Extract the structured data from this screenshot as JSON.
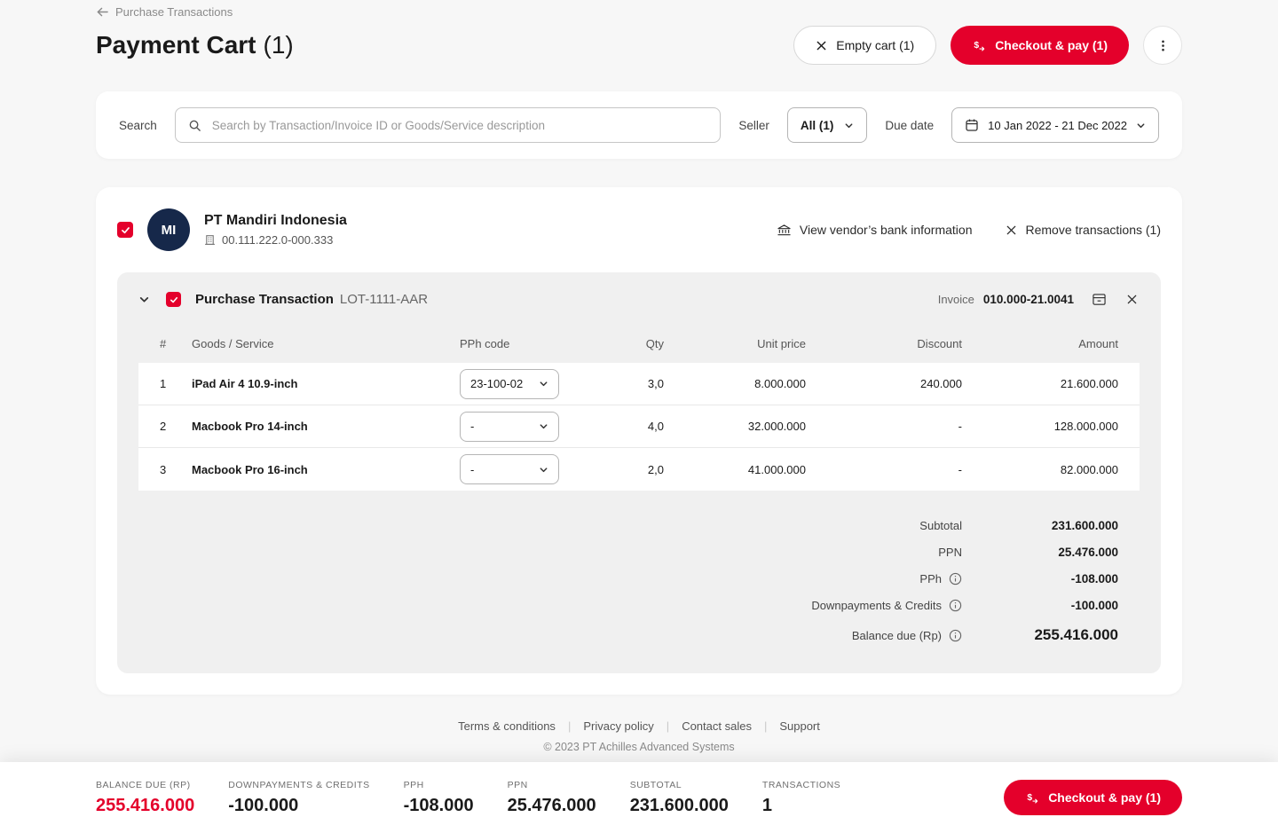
{
  "colors": {
    "accent": "#e4002b",
    "avatar_bg": "#16284a"
  },
  "header": {
    "back_label": "Purchase Transactions",
    "title": "Payment Cart",
    "title_count": "(1)",
    "empty_cart_label": "Empty cart (1)",
    "checkout_label": "Checkout & pay (1)"
  },
  "filters": {
    "search_label": "Search",
    "search_placeholder": "Search by Transaction/Invoice ID or Goods/Service description",
    "seller_label": "Seller",
    "seller_value": "All (1)",
    "due_date_label": "Due date",
    "due_date_value": "10 Jan 2022 - 21 Dec 2022"
  },
  "vendor": {
    "initials": "MI",
    "name": "PT Mandiri Indonesia",
    "tax_id": "00.111.222.0-000.333",
    "bank_info_label": "View vendor’s bank information",
    "remove_label": "Remove transactions (1)"
  },
  "transaction": {
    "title": "Purchase Transaction",
    "id": "LOT-1111-AAR",
    "invoice_label": "Invoice",
    "invoice_number": "010.000-21.0041"
  },
  "table": {
    "headers": [
      "#",
      "Goods / Service",
      "PPh code",
      "Qty",
      "Unit price",
      "Discount",
      "Amount"
    ],
    "rows": [
      {
        "num": "1",
        "goods": "iPad Air 4 10.9-inch",
        "pph_code": "23-100-02",
        "qty": "3,0",
        "unit_price": "8.000.000",
        "discount": "240.000",
        "amount": "21.600.000"
      },
      {
        "num": "2",
        "goods": "Macbook Pro 14-inch",
        "pph_code": "-",
        "qty": "4,0",
        "unit_price": "32.000.000",
        "discount": "-",
        "amount": "128.000.000"
      },
      {
        "num": "3",
        "goods": "Macbook Pro 16-inch",
        "pph_code": "-",
        "qty": "2,0",
        "unit_price": "41.000.000",
        "discount": "-",
        "amount": "82.000.000"
      }
    ]
  },
  "totals": [
    {
      "label": "Subtotal",
      "value": "231.600.000"
    },
    {
      "label": "PPN",
      "value": "25.476.000"
    },
    {
      "label": "PPh",
      "value": "-108.000"
    },
    {
      "label": "Downpayments & Credits",
      "value": "-100.000"
    },
    {
      "label": "Balance due (Rp)",
      "value": "255.416.000"
    }
  ],
  "footer": {
    "links": [
      "Terms & conditions",
      "Privacy policy",
      "Contact sales",
      "Support"
    ],
    "copyright": "© 2023 PT Achilles Advanced Systems"
  },
  "bottom_bar": {
    "items": [
      {
        "label": "BALANCE DUE (RP)",
        "value": "255.416.000"
      },
      {
        "label": "DOWNPAYMENTS & CREDITS",
        "value": "-100.000"
      },
      {
        "label": "PPH",
        "value": "-108.000"
      },
      {
        "label": "PPN",
        "value": "25.476.000"
      },
      {
        "label": "SUBTOTAL",
        "value": "231.600.000"
      },
      {
        "label": "TRANSACTIONS",
        "value": "1"
      }
    ],
    "checkout_label": "Checkout & pay (1)"
  }
}
